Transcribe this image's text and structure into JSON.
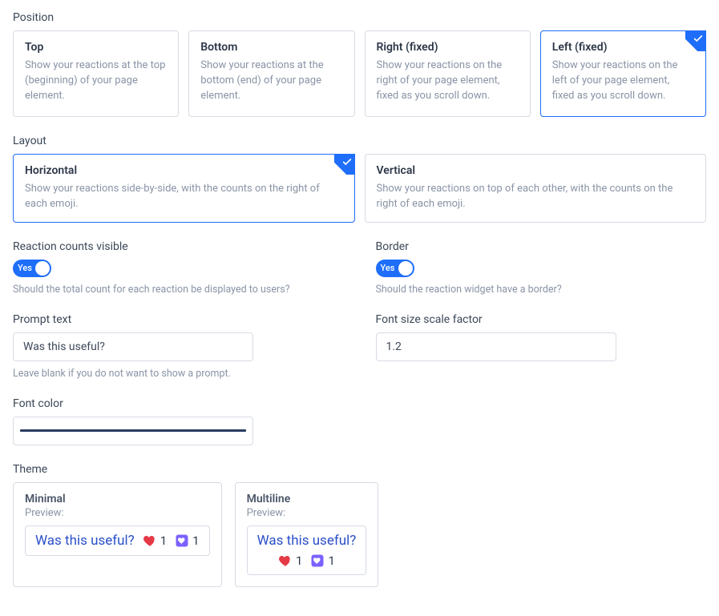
{
  "accent_color": "#1e6ef9",
  "position": {
    "label": "Position",
    "selected": 3,
    "options": [
      {
        "title": "Top",
        "desc": "Show your reactions at the top (beginning) of your page element."
      },
      {
        "title": "Bottom",
        "desc": "Show your reactions at the bottom (end) of your page element."
      },
      {
        "title": "Right (fixed)",
        "desc": "Show your reactions on the right of your page element, fixed as you scroll down."
      },
      {
        "title": "Left (fixed)",
        "desc": "Show your reactions on the left of your page element, fixed as you scroll down."
      }
    ]
  },
  "layout": {
    "label": "Layout",
    "selected": 0,
    "options": [
      {
        "title": "Horizontal",
        "desc": "Show your reactions side-by-side, with the counts on the right of each emoji."
      },
      {
        "title": "Vertical",
        "desc": "Show your reactions on top of each other, with the counts on the right of each emoji."
      }
    ]
  },
  "counts_visible": {
    "label": "Reaction counts visible",
    "value": true,
    "value_label": "Yes",
    "help": "Should the total count for each reaction be displayed to users?"
  },
  "border": {
    "label": "Border",
    "value": true,
    "value_label": "Yes",
    "help": "Should the reaction widget have a border?"
  },
  "prompt_text": {
    "label": "Prompt text",
    "value": "Was this useful?",
    "help": "Leave blank if you do not want to show a prompt."
  },
  "font_size_scale": {
    "label": "Font size scale factor",
    "value": "1.2"
  },
  "font_color": {
    "label": "Font color",
    "value": "#2a3b5f"
  },
  "theme": {
    "label": "Theme",
    "preview_label": "Preview:",
    "options": [
      {
        "title": "Minimal",
        "prompt": "Was this useful?",
        "r1_count": "1",
        "r2_count": "1",
        "layout": "row"
      },
      {
        "title": "Multiline",
        "prompt": "Was this useful?",
        "r1_count": "1",
        "r2_count": "1",
        "layout": "col"
      }
    ]
  },
  "icons": {
    "heart_fill": "#e63946",
    "heart_outline_bg": "#7b61ff"
  }
}
